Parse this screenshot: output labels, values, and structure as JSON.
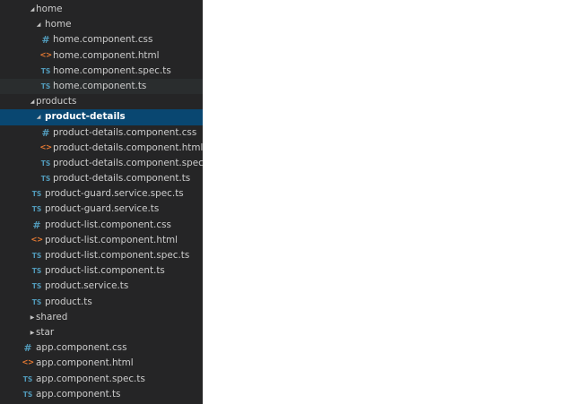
{
  "explorer": {
    "items": [
      {
        "label": "home",
        "kind": "folder",
        "expanded": true,
        "depth": 0,
        "icon": "chevron-down-icon"
      },
      {
        "label": "home",
        "kind": "folder",
        "expanded": true,
        "depth": 1,
        "icon": "chevron-down-icon"
      },
      {
        "label": "home.component.css",
        "kind": "css",
        "depth": 2,
        "icon": "#"
      },
      {
        "label": "home.component.html",
        "kind": "html",
        "depth": 2,
        "icon": "<>"
      },
      {
        "label": "home.component.spec.ts",
        "kind": "ts",
        "depth": 2,
        "icon": "TS"
      },
      {
        "label": "home.component.ts",
        "kind": "ts",
        "depth": 2,
        "icon": "TS",
        "state": "hover"
      },
      {
        "label": "products",
        "kind": "folder",
        "expanded": true,
        "depth": 0,
        "icon": "chevron-down-icon"
      },
      {
        "label": "product-details",
        "kind": "folder",
        "expanded": true,
        "depth": 1,
        "icon": "chevron-down-icon",
        "state": "selected"
      },
      {
        "label": "product-details.component.css",
        "kind": "css",
        "depth": 2,
        "icon": "#"
      },
      {
        "label": "product-details.component.html",
        "kind": "html",
        "depth": 2,
        "icon": "<>"
      },
      {
        "label": "product-details.component.spec.ts",
        "kind": "ts",
        "depth": 2,
        "icon": "TS"
      },
      {
        "label": "product-details.component.ts",
        "kind": "ts",
        "depth": 2,
        "icon": "TS"
      },
      {
        "label": "product-guard.service.spec.ts",
        "kind": "ts",
        "depth": 1,
        "icon": "TS"
      },
      {
        "label": "product-guard.service.ts",
        "kind": "ts",
        "depth": 1,
        "icon": "TS"
      },
      {
        "label": "product-list.component.css",
        "kind": "css",
        "depth": 1,
        "icon": "#"
      },
      {
        "label": "product-list.component.html",
        "kind": "html",
        "depth": 1,
        "icon": "<>"
      },
      {
        "label": "product-list.component.spec.ts",
        "kind": "ts",
        "depth": 1,
        "icon": "TS"
      },
      {
        "label": "product-list.component.ts",
        "kind": "ts",
        "depth": 1,
        "icon": "TS"
      },
      {
        "label": "product.service.ts",
        "kind": "ts",
        "depth": 1,
        "icon": "TS"
      },
      {
        "label": "product.ts",
        "kind": "ts",
        "depth": 1,
        "icon": "TS"
      },
      {
        "label": "shared",
        "kind": "folder",
        "expanded": false,
        "depth": 0,
        "icon": "chevron-right-icon"
      },
      {
        "label": "star",
        "kind": "folder",
        "expanded": false,
        "depth": 0,
        "icon": "chevron-right-icon"
      },
      {
        "label": "app.component.css",
        "kind": "css",
        "depth": 0,
        "icon": "#"
      },
      {
        "label": "app.component.html",
        "kind": "html",
        "depth": 0,
        "icon": "<>"
      },
      {
        "label": "app.component.spec.ts",
        "kind": "ts",
        "depth": 0,
        "icon": "TS"
      },
      {
        "label": "app.component.ts",
        "kind": "ts",
        "depth": 0,
        "icon": "TS"
      }
    ]
  },
  "colors": {
    "sidebar_bg": "#252526",
    "selected_bg": "#094771",
    "hover_bg": "#2a2d2e",
    "text": "#cccccc",
    "css_icon": "#519aba",
    "ts_icon": "#519aba",
    "html_icon": "#e37933"
  }
}
